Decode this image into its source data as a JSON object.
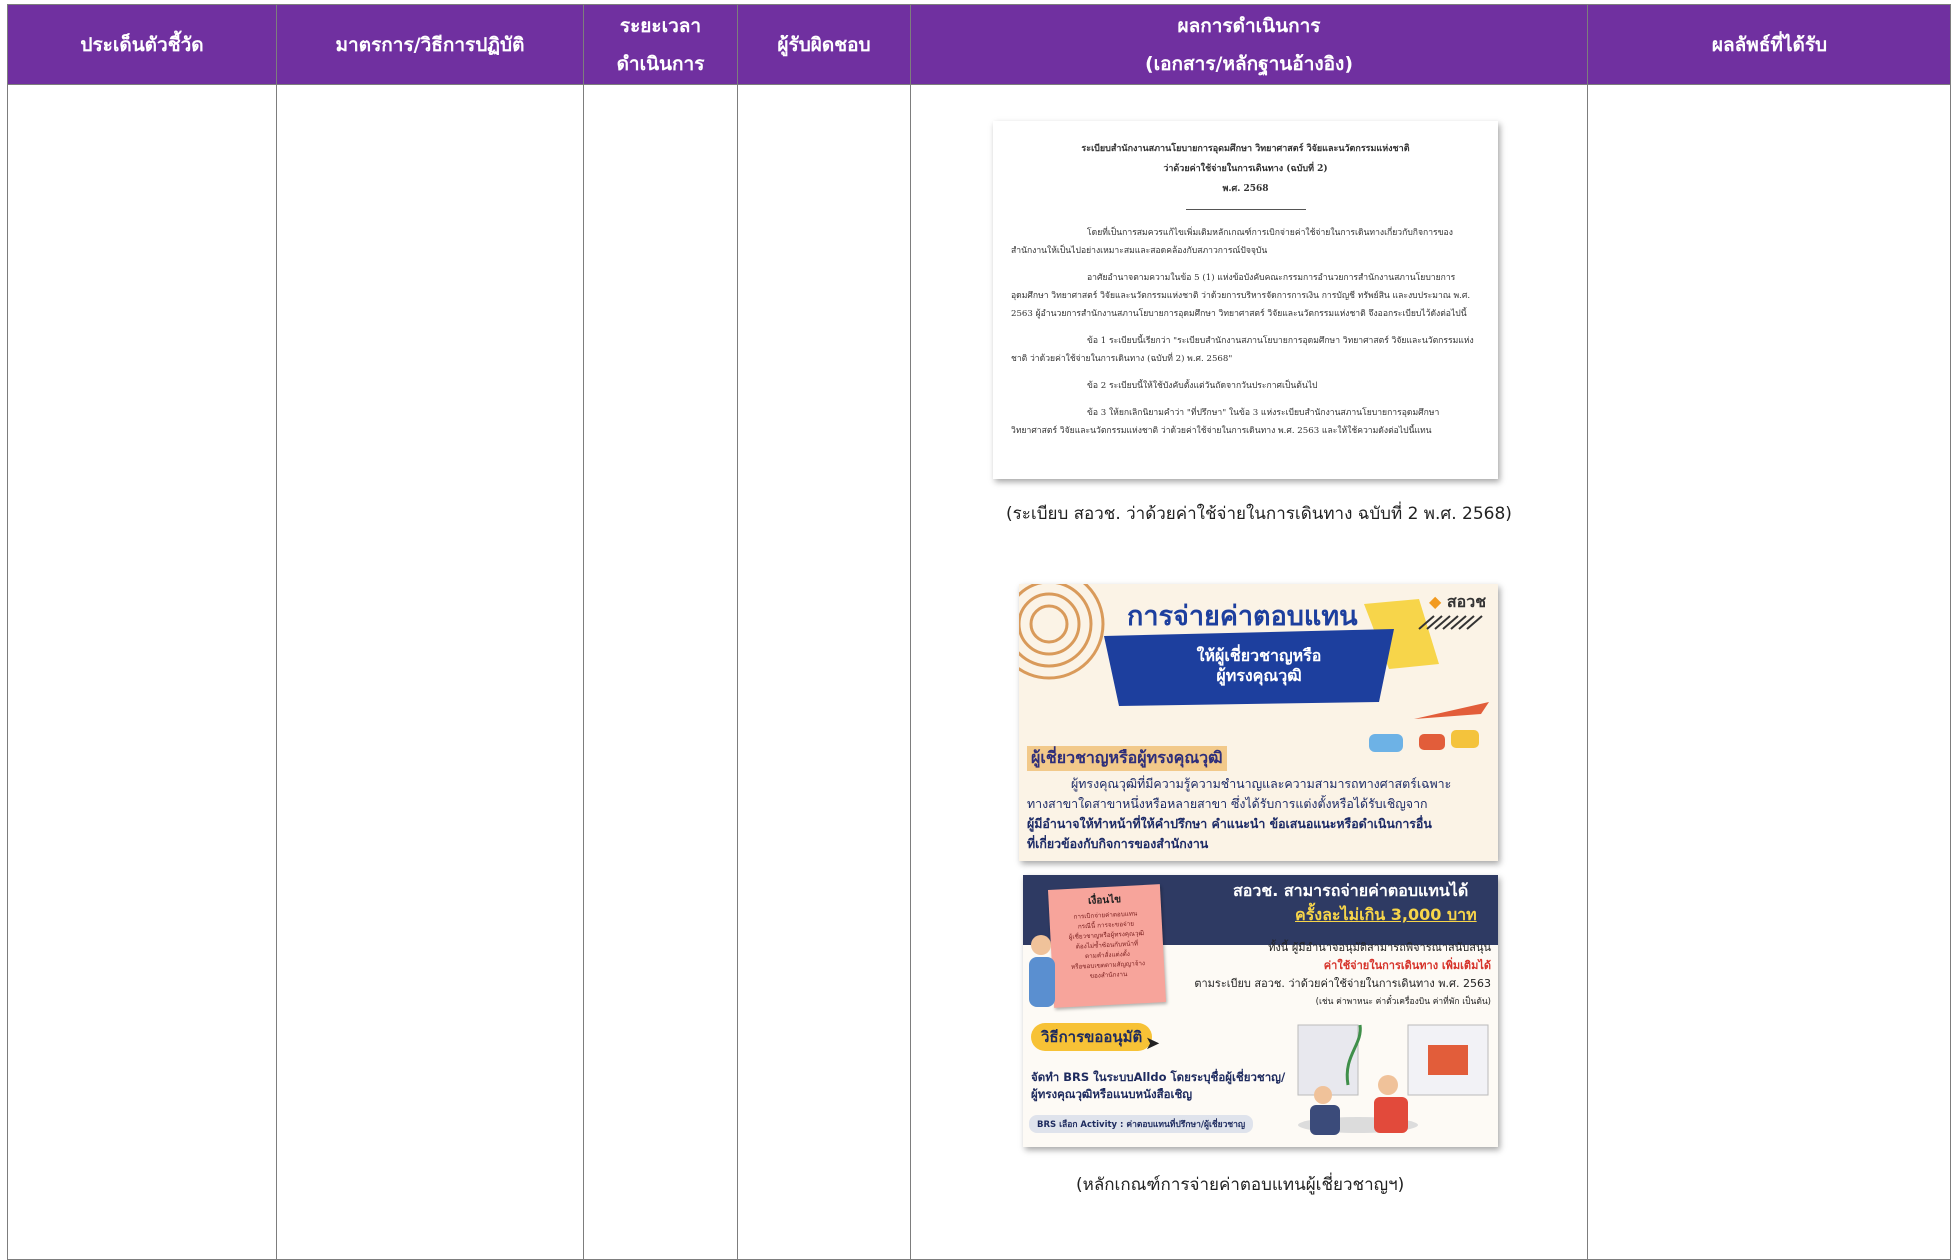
{
  "header": {
    "col1": "ประเด็นตัวชี้วัด",
    "col2": "มาตรการ/วิธีการปฏิบัติ",
    "col3": [
      "ระยะเวลา",
      "ดำเนินการ"
    ],
    "col4": "ผู้รับผิดชอบ",
    "col5": [
      "ผลการดำเนินการ",
      "(เอกสาร/หลักฐานอ้างอิง)"
    ],
    "col6": "ผลลัพธ์ที่ได้รับ"
  },
  "regulation": {
    "title": [
      "ระเบียบสำนักงานสภานโยบายการอุดมศึกษา วิทยาศาสตร์ วิจัยและนวัตกรรมแห่งชาติ",
      "ว่าด้วยค่าใช้จ่ายในการเดินทาง (ฉบับที่ 2)",
      "พ.ศ. 2568"
    ],
    "paragraphs": [
      "โดยที่เป็นการสมควรแก้ไขเพิ่มเติมหลักเกณฑ์การเบิกจ่ายค่าใช้จ่ายในการเดินทางเกี่ยวกับกิจการของสำนักงานให้เป็นไปอย่างเหมาะสมและสอดคล้องกับสภาวการณ์ปัจจุบัน",
      "อาศัยอำนาจตามความในข้อ 5 (1) แห่งข้อบังคับคณะกรรมการอำนวยการสำนักงานสภานโยบายการอุดมศึกษา วิทยาศาสตร์ วิจัยและนวัตกรรมแห่งชาติ ว่าด้วยการบริหารจัดการการเงิน การบัญชี ทรัพย์สิน และงบประมาณ พ.ศ. 2563 ผู้อำนวยการสำนักงานสภานโยบายการอุดมศึกษา วิทยาศาสตร์ วิจัยและนวัตกรรมแห่งชาติ จึงออกระเบียบไว้ดังต่อไปนี้",
      "ข้อ 1 ระเบียบนี้เรียกว่า \"ระเบียบสำนักงานสภานโยบายการอุดมศึกษา วิทยาศาสตร์ วิจัยและนวัตกรรมแห่งชาติ ว่าด้วยค่าใช้จ่ายในการเดินทาง (ฉบับที่ 2) พ.ศ. 2568\"",
      "ข้อ 2 ระเบียบนี้ให้ใช้บังคับตั้งแต่วันถัดจากวันประกาศเป็นต้นไป",
      "ข้อ 3 ให้ยกเลิกนิยามคำว่า \"ที่ปรึกษา\" ในข้อ 3 แห่งระเบียบสำนักงานสภานโยบายการอุดมศึกษา วิทยาศาสตร์ วิจัยและนวัตกรรมแห่งชาติ ว่าด้วยค่าใช้จ่ายในการเดินทาง พ.ศ. 2563 และให้ใช้ความดังต่อไปนี้แทน"
    ]
  },
  "caption1": "(ระเบียบ สอวช. ว่าด้วยค่าใช้จ่ายในการเดินทาง ฉบับที่ 2 พ.ศ. 2568)",
  "infographic1": {
    "heading": "การจ่ายค่าตอบแทน",
    "logo": "สอวช",
    "banner": [
      "ให้ผู้เชี่ยวชาญหรือ",
      "ผู้ทรงคุณวุฒิ"
    ],
    "section": "ผู้เชี่ยวชาญหรือผู้ทรงคุณวุฒิ",
    "body_lines": [
      "ผู้ทรงคุณวุฒิที่มีความรู้ความชำนาญและความสามารถทางศาสตร์เฉพาะ",
      "ทางสาขาใดสาขาหนึ่งหรือหลายสาขา ซึ่งได้รับการแต่งตั้งหรือได้รับเชิญจาก",
      "ผู้มีอำนาจให้ทำหน้าที่ให้คำปรึกษา คำแนะนำ ข้อเสนอแนะหรือดำเนินการอื่น",
      "ที่เกี่ยวข้องกับกิจการของสำนักงาน"
    ],
    "accent": "#1d3f9e"
  },
  "infographic2": {
    "note_title": "เงื่อนไข",
    "note_lines": [
      "การเบิกจ่ายค่าตอบแทน",
      "กรณีนี้ การจะขอจ่าย",
      "ผู้เชี่ยวชาญหรือผู้ทรงคุณวุฒิ",
      "ต้องไม่ซ้ำซ้อนกับหน้าที่",
      "ตามคำสั่งแต่งตั้ง",
      "หรือขอบเขตตามสัญญาจ้าง",
      "ของสำนักงาน"
    ],
    "headline": "สอวช. สามารถจ่ายค่าตอบแทนได้",
    "amount": "ครั้งละไม่เกิน 3,000 บาท",
    "detail_lines": [
      "ทั้งนี้ ผู้มีอำนาจอนุมัติสามารถพิจารณาสนับสนุน",
      "ค่าใช้จ่ายในการเดินทาง เพิ่มเติมได้",
      "ตามระเบียบ สอวช. ว่าด้วยค่าใช้จ่ายในการเดินทาง พ.ศ. 2563",
      "(เช่น ค่าพาหนะ ค่าตั๋วเครื่องบิน ค่าที่พัก เป็นต้น)"
    ],
    "method_label": "วิธีการขออนุมัติ",
    "method_lines": [
      "จัดทำ BRS ในระบบAlldo โดยระบุชื่อผู้เชี่ยวชาญ/",
      "ผู้ทรงคุณวุฒิหรือแนบหนังสือเชิญ"
    ],
    "activity": "BRS เลือก Activity : ค่าตอบแทนที่ปรึกษา/ผู้เชี่ยวชาญ"
  },
  "caption2": "(หลักเกณฑ์การจ่ายค่าตอบแทนผู้เชี่ยวชาญฯ)",
  "colors": {
    "header_bg": "#7030a0",
    "header_text": "#ffffff",
    "border": "#7d7d7d"
  }
}
